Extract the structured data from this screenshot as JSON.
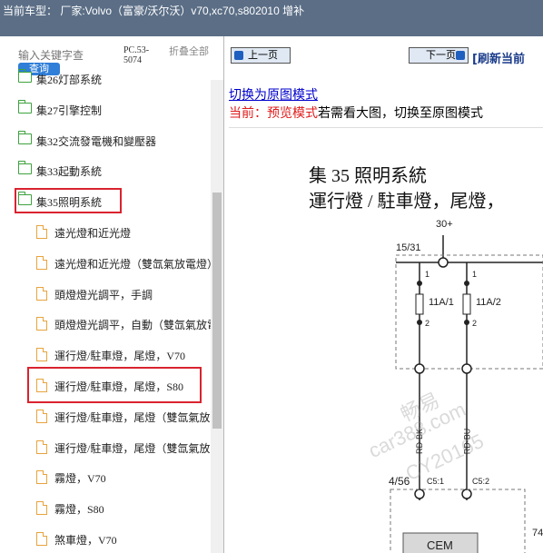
{
  "titlebar": {
    "text": "当前车型：  厂家:Volvo（富豪/沃尔沃）v70,xc70,s802010 增补"
  },
  "search": {
    "placeholder": "输入关键字查",
    "button": "查询",
    "code": "PC.53-5074",
    "collapse": "折叠全部"
  },
  "tree": {
    "items": [
      {
        "label": "集26灯部系统",
        "type": "folder"
      },
      {
        "label": "集27引擎控制",
        "type": "folder"
      },
      {
        "label": "集32交流發電機和變壓器",
        "type": "folder"
      },
      {
        "label": "集33起動系統",
        "type": "folder"
      },
      {
        "label": "集35照明系統",
        "type": "folder-open"
      },
      {
        "label": "遠光燈和近光燈",
        "type": "doc"
      },
      {
        "label": "遠光燈和近光燈（雙氙氣放電燈）",
        "type": "doc"
      },
      {
        "label": "頭燈燈光調平，手調",
        "type": "doc"
      },
      {
        "label": "頭燈燈光調平，自動（雙氙氣放電燈）",
        "type": "doc"
      },
      {
        "label": "運行燈/駐車燈，尾燈，V70",
        "type": "doc"
      },
      {
        "label": "運行燈/駐車燈，尾燈，S80",
        "type": "doc"
      },
      {
        "label": "運行燈/駐車燈，尾燈（雙氙氣放電燈）",
        "type": "doc"
      },
      {
        "label": "運行燈/駐車燈，尾燈（雙氙氣放電燈）",
        "type": "doc"
      },
      {
        "label": "霧燈，V70",
        "type": "doc"
      },
      {
        "label": "霧燈，S80",
        "type": "doc"
      },
      {
        "label": "煞車燈，V70",
        "type": "doc"
      }
    ]
  },
  "viewer": {
    "prev": "上一页",
    "next": "下一页",
    "refresh": "[刷新当前",
    "mode_link": "切换为原图模式",
    "status_prefix": "当前：预览模式",
    "status_rest": "若需看大图，切换至原图模式"
  },
  "diagram": {
    "title": "集 35 照明系統",
    "subtitle": "運行燈 / 駐車燈，尾燈，",
    "labels": {
      "supply": "30+",
      "node": "15/31",
      "fuse1": "11A/1",
      "fuse2": "11A/2",
      "pin1a": "1",
      "pin1b": "1",
      "pin2a": "2",
      "pin2b": "2",
      "wire1": "RD-BK",
      "wire2": "RD-BU",
      "module": "4/56",
      "c1": "C5:1",
      "c2": "C5:2",
      "cem": "CEM",
      "side": "74"
    },
    "watermarks": [
      "畅易",
      "car388.com",
      "CY20165"
    ]
  },
  "colors": {
    "highlight": "#d9232e",
    "folder": "#3ea23e",
    "doc": "#e8a33d",
    "titlebar": "#5b6e86"
  }
}
